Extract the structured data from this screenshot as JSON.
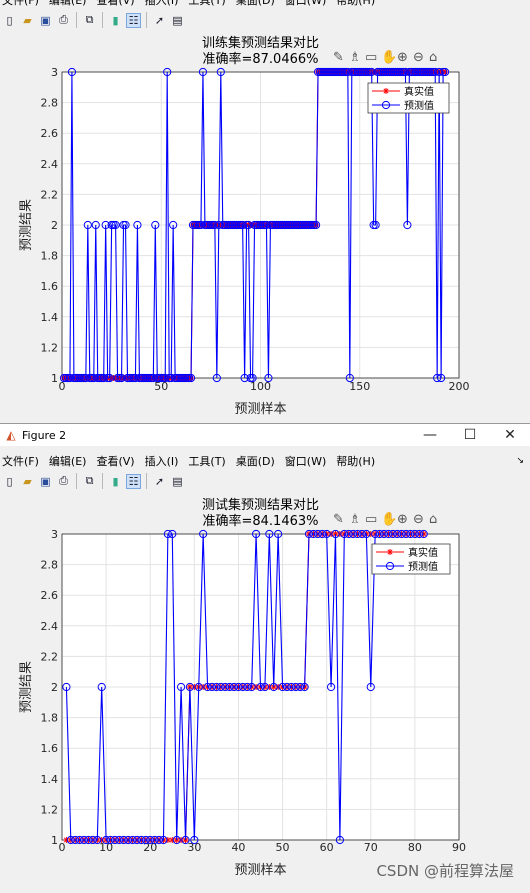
{
  "menu": [
    "文件(F)",
    "编辑(E)",
    "查看(V)",
    "插入(I)",
    "工具(T)",
    "桌面(D)",
    "窗口(W)",
    "帮助(H)"
  ],
  "figure2": {
    "title": "Figure 2"
  },
  "toolbar_icons": [
    "new-figure-icon",
    "open-file-icon",
    "save-icon",
    "print-icon",
    "link-plot-icon",
    "colorbar-icon",
    "legend-icon",
    "pointer-icon",
    "property-editor-icon"
  ],
  "axes_toolbar_icons": [
    "brush-icon",
    "data-tips-icon",
    "restore-view-icon",
    "pan-icon",
    "zoom-in-icon",
    "zoom-out-icon",
    "home-icon"
  ],
  "watermark": "CSDN @前程算法屋",
  "colors": {
    "true_series": "#ff0000",
    "pred_series": "#0000ff",
    "figure_bg": "#f0f0f0"
  },
  "chart_data": [
    {
      "type": "line",
      "title": "训练集预测结果对比",
      "subtitle": "准确率=87.0466%",
      "xlabel": "预测样本",
      "ylabel": "预测结果",
      "xlim": [
        0,
        200
      ],
      "ylim": [
        1,
        3
      ],
      "xticks": [
        "0",
        "50",
        "100",
        "150",
        "200"
      ],
      "yticks": [
        "1",
        "1.2",
        "1.4",
        "1.6",
        "1.8",
        "2",
        "2.2",
        "2.4",
        "2.6",
        "2.8",
        "3"
      ],
      "grid": true,
      "legend_position": "top-right",
      "n": 193,
      "series": [
        {
          "name": "真实值",
          "color": "#ff0000",
          "marker": "*",
          "runs": [
            [
              1,
              65,
              1
            ],
            [
              66,
              128,
              2
            ],
            [
              129,
              193,
              3
            ]
          ]
        },
        {
          "name": "预测值",
          "color": "#0000ff",
          "marker": "o",
          "runs": [
            [
              1,
              65,
              1
            ],
            [
              66,
              128,
              2
            ],
            [
              129,
              193,
              3
            ]
          ],
          "overrides": [
            [
              5,
              3
            ],
            [
              13,
              2
            ],
            [
              17,
              2
            ],
            [
              22,
              2
            ],
            [
              25,
              2
            ],
            [
              26,
              2
            ],
            [
              27,
              2
            ],
            [
              31,
              2
            ],
            [
              32,
              2
            ],
            [
              38,
              2
            ],
            [
              47,
              2
            ],
            [
              53,
              3
            ],
            [
              56,
              2
            ],
            [
              71,
              3
            ],
            [
              78,
              1
            ],
            [
              80,
              3
            ],
            [
              92,
              1
            ],
            [
              94,
              2
            ],
            [
              95,
              1
            ],
            [
              96,
              1
            ],
            [
              104,
              1
            ],
            [
              145,
              1
            ],
            [
              157,
              2
            ],
            [
              158,
              2
            ],
            [
              174,
              2
            ],
            [
              189,
              1
            ],
            [
              191,
              1
            ]
          ]
        }
      ]
    },
    {
      "type": "line",
      "title": "测试集预测结果对比",
      "subtitle": "准确率=84.1463%",
      "xlabel": "预测样本",
      "ylabel": "预测结果",
      "xlim": [
        0,
        90
      ],
      "ylim": [
        1,
        3
      ],
      "xticks": [
        "0",
        "10",
        "20",
        "30",
        "40",
        "50",
        "60",
        "70",
        "80",
        "90"
      ],
      "yticks": [
        "1",
        "1.2",
        "1.4",
        "1.6",
        "1.8",
        "2",
        "2.2",
        "2.4",
        "2.6",
        "2.8",
        "3"
      ],
      "grid": true,
      "legend_position": "top-right",
      "n": 82,
      "series": [
        {
          "name": "真实值",
          "color": "#ff0000",
          "marker": "*",
          "runs": [
            [
              1,
              28,
              1
            ],
            [
              29,
              55,
              2
            ],
            [
              56,
              82,
              3
            ]
          ]
        },
        {
          "name": "预测值",
          "color": "#0000ff",
          "marker": "o",
          "runs": [
            [
              1,
              28,
              1
            ],
            [
              29,
              55,
              2
            ],
            [
              56,
              82,
              3
            ]
          ],
          "overrides": [
            [
              1,
              2
            ],
            [
              9,
              2
            ],
            [
              24,
              3
            ],
            [
              25,
              3
            ],
            [
              27,
              2
            ],
            [
              30,
              1
            ],
            [
              32,
              3
            ],
            [
              44,
              3
            ],
            [
              47,
              3
            ],
            [
              49,
              3
            ],
            [
              61,
              2
            ],
            [
              63,
              1
            ],
            [
              70,
              2
            ]
          ]
        }
      ]
    }
  ]
}
